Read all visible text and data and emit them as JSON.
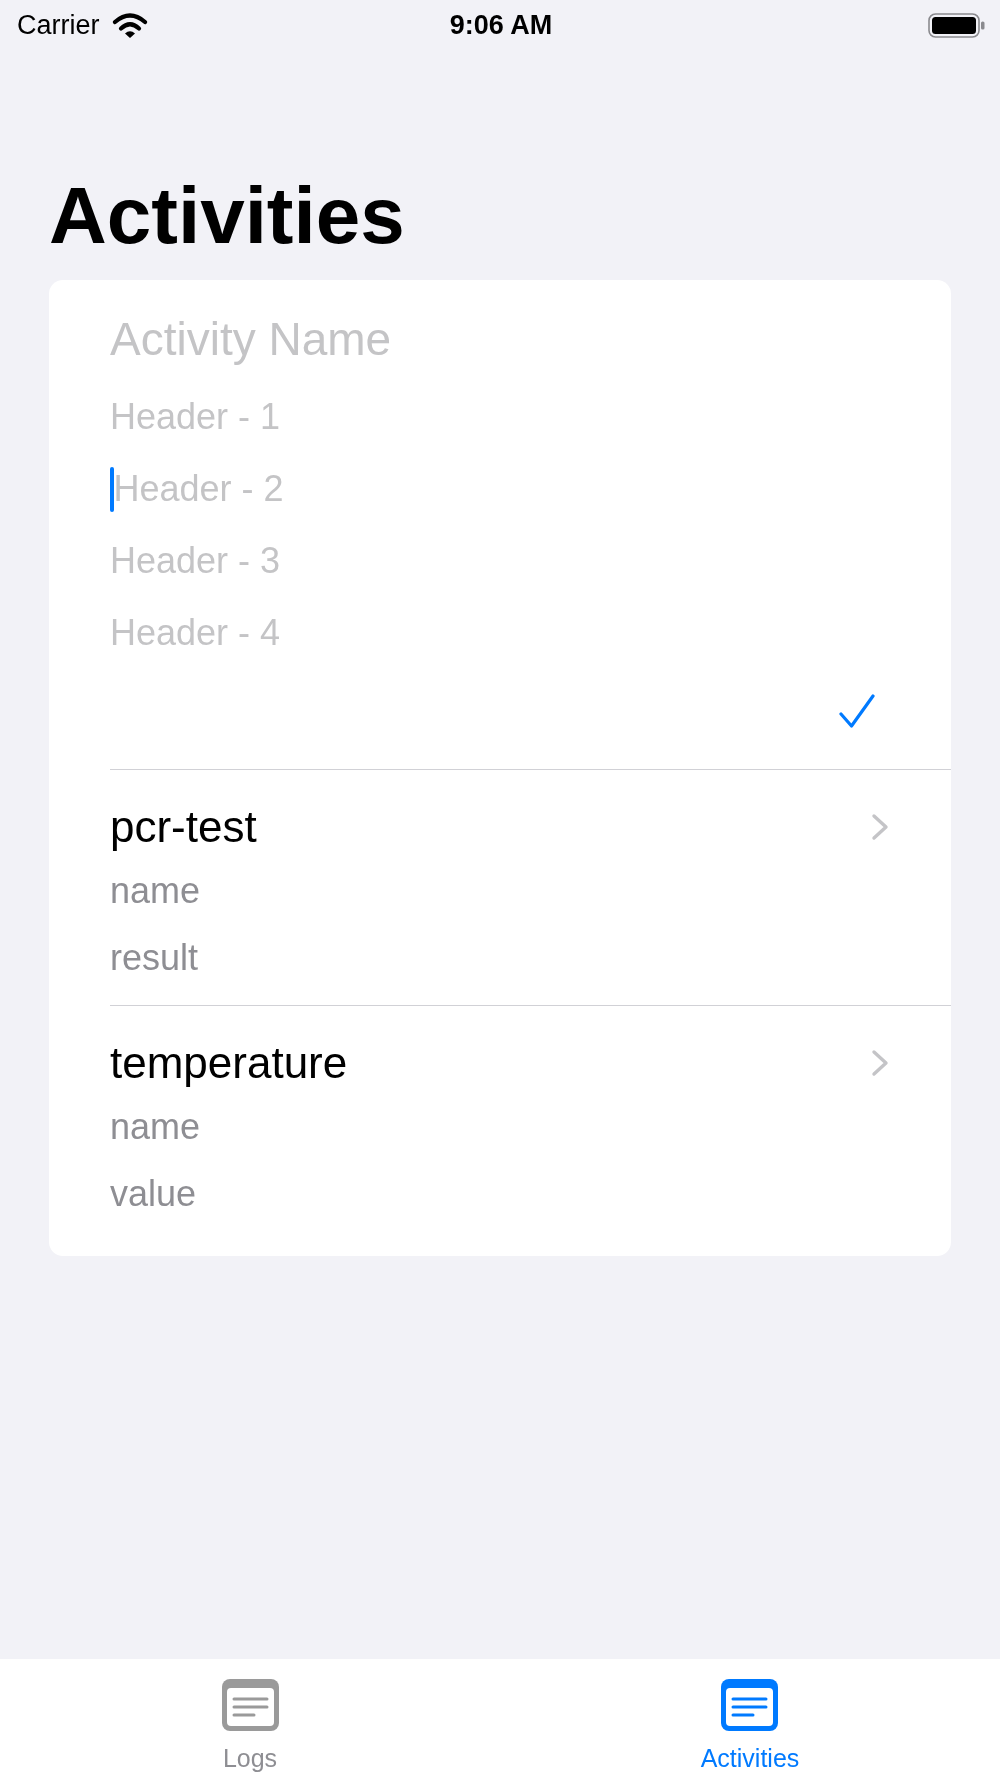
{
  "status_bar": {
    "carrier": "Carrier",
    "time": "9:06 AM"
  },
  "title": "Activities",
  "form": {
    "name_field": {
      "placeholder": "Activity Name"
    },
    "header_fields": [
      {
        "placeholder": "Header - 1",
        "focused": false
      },
      {
        "placeholder": "Header - 2",
        "focused": true
      },
      {
        "placeholder": "Header - 3",
        "focused": false
      },
      {
        "placeholder": "Header - 4",
        "focused": false
      }
    ]
  },
  "activities": [
    {
      "title": "pcr-test",
      "fields": [
        "name",
        "result"
      ]
    },
    {
      "title": "temperature",
      "fields": [
        "name",
        "value"
      ]
    }
  ],
  "tab_bar": {
    "tabs": [
      {
        "label": "Logs",
        "selected": false
      },
      {
        "label": "Activities",
        "selected": true
      }
    ]
  }
}
